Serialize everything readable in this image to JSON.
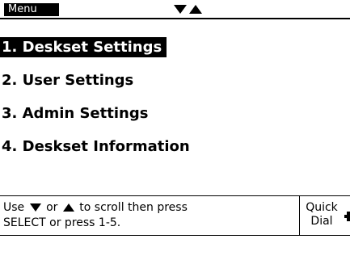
{
  "header": {
    "menu_label": "Menu",
    "down_arrow_icon": "down-arrow-icon",
    "up_arrow_icon": "up-arrow-icon"
  },
  "menu": {
    "items": [
      {
        "label": "1. Deskset Settings",
        "selected": true
      },
      {
        "label": "2. User Settings",
        "selected": false
      },
      {
        "label": "3. Admin Settings",
        "selected": false
      },
      {
        "label": "4. Deskset Information",
        "selected": false
      }
    ]
  },
  "footer": {
    "help_use": "Use",
    "help_or": "or",
    "help_scroll": "to scroll then press",
    "help_line2": "SELECT or press 1-5.",
    "softkey_line1": "Quick",
    "softkey_line2": "Dial",
    "softkey_icon": "plus-key-icon"
  }
}
